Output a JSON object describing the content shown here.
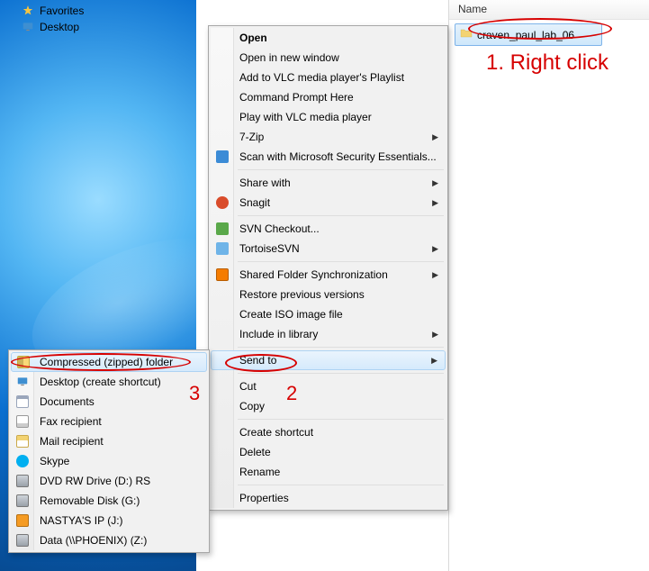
{
  "nav": {
    "favorites": "Favorites",
    "desktop": "Desktop"
  },
  "file_pane": {
    "column_header": "Name",
    "selected_file": "craven_paul_lab_06"
  },
  "annotations": {
    "step1": "1. Right click",
    "step2": "2",
    "step3": "3"
  },
  "ctx_main": [
    {
      "kind": "item",
      "label": "Open",
      "bold": true
    },
    {
      "kind": "item",
      "label": "Open in new window"
    },
    {
      "kind": "item",
      "label": "Add to VLC media player's Playlist"
    },
    {
      "kind": "item",
      "label": "Command Prompt Here"
    },
    {
      "kind": "item",
      "label": "Play with VLC media player"
    },
    {
      "kind": "item",
      "label": "7-Zip",
      "submenu": true
    },
    {
      "kind": "item",
      "label": "Scan with Microsoft Security Essentials...",
      "icon": "shield-blue"
    },
    {
      "kind": "sep"
    },
    {
      "kind": "item",
      "label": "Share with",
      "submenu": true
    },
    {
      "kind": "item",
      "label": "Snagit",
      "submenu": true,
      "icon": "snagit-orange"
    },
    {
      "kind": "sep"
    },
    {
      "kind": "item",
      "label": "SVN Checkout...",
      "icon": "svn-checkout"
    },
    {
      "kind": "item",
      "label": "TortoiseSVN",
      "submenu": true,
      "icon": "tortoise"
    },
    {
      "kind": "sep"
    },
    {
      "kind": "item",
      "label": "Shared Folder Synchronization",
      "submenu": true,
      "icon": "sync-orange"
    },
    {
      "kind": "item",
      "label": "Restore previous versions"
    },
    {
      "kind": "item",
      "label": "Create ISO image file"
    },
    {
      "kind": "item",
      "label": "Include in library",
      "submenu": true
    },
    {
      "kind": "sep"
    },
    {
      "kind": "item",
      "label": "Send to",
      "submenu": true,
      "highlight": true
    },
    {
      "kind": "sep"
    },
    {
      "kind": "item",
      "label": "Cut"
    },
    {
      "kind": "item",
      "label": "Copy"
    },
    {
      "kind": "sep"
    },
    {
      "kind": "item",
      "label": "Create shortcut"
    },
    {
      "kind": "item",
      "label": "Delete"
    },
    {
      "kind": "item",
      "label": "Rename"
    },
    {
      "kind": "sep"
    },
    {
      "kind": "item",
      "label": "Properties"
    }
  ],
  "ctx_sendto": [
    {
      "label": "Compressed (zipped) folder",
      "icon": "zip",
      "highlight": true
    },
    {
      "label": "Desktop (create shortcut)",
      "icon": "desktop"
    },
    {
      "label": "Documents",
      "icon": "doc"
    },
    {
      "label": "Fax recipient",
      "icon": "fax"
    },
    {
      "label": "Mail recipient",
      "icon": "mail"
    },
    {
      "label": "Skype",
      "icon": "skype"
    },
    {
      "label": "DVD RW Drive (D:) RS",
      "icon": "drive"
    },
    {
      "label": "Removable Disk (G:)",
      "icon": "drive"
    },
    {
      "label": "NASTYA'S IP (J:)",
      "icon": "drive-orange"
    },
    {
      "label": "Data (\\\\PHOENIX) (Z:)",
      "icon": "drive"
    }
  ]
}
